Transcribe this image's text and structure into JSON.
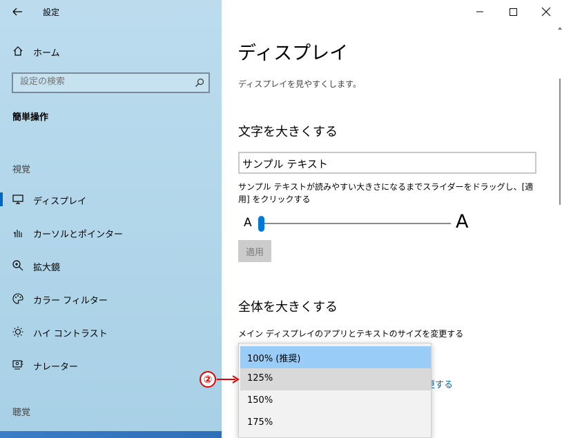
{
  "app": {
    "title": "設定"
  },
  "sidebar": {
    "home_label": "ホーム",
    "search_placeholder": "設定の検索",
    "section_heading": "簡単操作",
    "category_vision": "視覚",
    "category_hearing": "聴覚",
    "items": [
      {
        "label": "ディスプレイ",
        "icon": "monitor-icon",
        "selected": true
      },
      {
        "label": "カーソルとポインター",
        "icon": "pointer-icon",
        "selected": false
      },
      {
        "label": "拡大鏡",
        "icon": "magnifier-icon",
        "selected": false
      },
      {
        "label": "カラー フィルター",
        "icon": "palette-icon",
        "selected": false
      },
      {
        "label": "ハイ コントラスト",
        "icon": "brightness-icon",
        "selected": false
      },
      {
        "label": "ナレーター",
        "icon": "narrator-icon",
        "selected": false
      }
    ]
  },
  "main": {
    "title": "ディスプレイ",
    "subtitle": "ディスプレイを見やすくします。",
    "text_size": {
      "heading": "文字を大きくする",
      "sample_text": "サンプル テキスト",
      "description": "サンプル テキストが読みやすい大きさになるまでスライダーをドラッグし、[適用] をクリックする",
      "small_a": "A",
      "large_a": "A",
      "slider_percent": 0,
      "apply_label": "適用"
    },
    "scale": {
      "heading": "全体を大きくする",
      "description": "メイン ディスプレイのアプリとテキストのサイズを変更する",
      "link_partial": "更する",
      "options": [
        "100% (推奨)",
        "125%",
        "150%",
        "175%"
      ],
      "selected": "100% (推奨)",
      "hovered": "125%"
    }
  },
  "annotation": {
    "number": "②",
    "color": "#e60000"
  },
  "colors": {
    "accent": "#0078d7",
    "sidebar_bg": "#b2d6ea",
    "selected_option": "#99ccf7"
  }
}
